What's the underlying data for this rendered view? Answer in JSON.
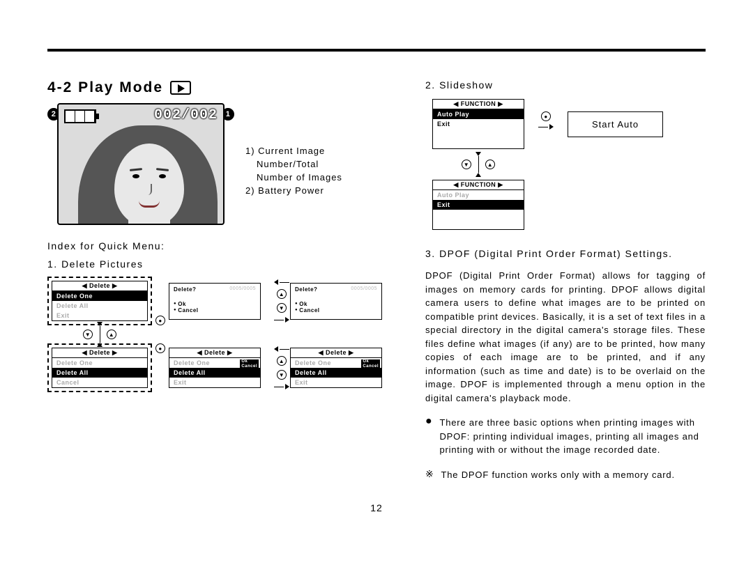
{
  "page_number": "12",
  "heading": "4-2 Play Mode",
  "lcd": {
    "counter": "002/002"
  },
  "callouts": {
    "one": "1",
    "two": "2"
  },
  "legend": {
    "l1": "1) Current Image",
    "l2": "Number/Total",
    "l3": "Number of Images",
    "l4": "2) Battery Power"
  },
  "quick_menu_label": "Index for Quick Menu:",
  "section1": "1. Delete Pictures",
  "delete_menu": {
    "title": "◀ Delete ▶",
    "opt1": "Delete One",
    "opt2": "Delete All",
    "opt3": "Exit",
    "opt_cancel": "Cancel"
  },
  "confirm": {
    "q": "Delete?",
    "count": "0005/0005",
    "ok": "Ok",
    "cancel": "Cancel"
  },
  "overlay": {
    "ok": "Ok",
    "cancel": "Cancel"
  },
  "section2": "2. Slideshow",
  "func_menu": {
    "title": "◀ FUNCTION ▶",
    "opt1": "Auto Play",
    "opt2": "Exit"
  },
  "start_auto": "Start Auto",
  "section3": "3. DPOF (Digital Print Order Format) Settings.",
  "dpof_para": "DPOF (Digital Print Order Format) allows for tagging of images on memory cards for printing. DPOF allows digital camera users to define what images are to be printed on compatible print devices. Basically, it is a set of text files in a special directory in the digital camera's storage files. These files define what images (if any) are to be printed, how many copies of each image are to be printed, and if any information (such as time and date) is to be overlaid on the image. DPOF is implemented through a menu option in the digital camera's playback mode.",
  "bullet1": "There are three basic options when printing images with DPOF: printing individual images, printing all images and printing with or without the image recorded date.",
  "bullet2": "The DPOF function works only with a memory card."
}
